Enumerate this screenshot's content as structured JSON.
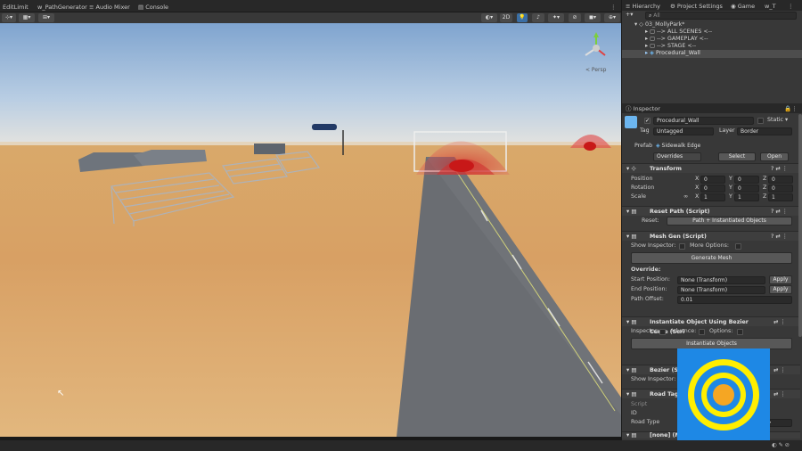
{
  "tabs": {
    "edit_limit": "EditLimit",
    "path_generator": "w_PathGenerator",
    "audio_mixer": "Audio Mixer",
    "console": "Console"
  },
  "scene_toolbar": {
    "mode_2d": "2D"
  },
  "hierarchy": {
    "tab_hierarchy": "Hierarchy",
    "tab_project_settings": "Project Settings",
    "tab_game": "Game",
    "tab_more": "w_T",
    "search_placeholder": "All",
    "scene_name": "03_MollyPark*",
    "items": [
      "--> ALL SCENES <--",
      "--> GAMEPLAY <--",
      "--> STAGE <--",
      "Procedural_Wall"
    ]
  },
  "inspector": {
    "tab_label": "Inspector",
    "object_name": "Procedural_Wall",
    "static_label": "Static",
    "tag_label": "Tag",
    "tag_value": "Untagged",
    "layer_label": "Layer",
    "layer_value": "Border",
    "prefab_label": "Prefab",
    "prefab_value": "Sidewalk Edge",
    "overrides": "Overrides",
    "select": "Select",
    "open": "Open",
    "transform": {
      "title": "Transform",
      "position_label": "Position",
      "rotation_label": "Rotation",
      "scale_label": "Scale",
      "x": "X",
      "y": "Y",
      "z": "Z",
      "pos": [
        "0",
        "0",
        "0"
      ],
      "rot": [
        "0",
        "0",
        "0"
      ],
      "scale": [
        "1",
        "1",
        "1"
      ]
    },
    "reset_path": {
      "title": "Reset Path (Script)",
      "reset_label": "Reset:",
      "reset_button": "Path + Instantiated Objects"
    },
    "mesh_gen": {
      "title": "Mesh Gen (Script)",
      "show_inspector": "Show Inspector:",
      "more_options": "More Options:",
      "generate_button": "Generate Mesh",
      "override_label": "Override:",
      "start_position_label": "Start Position:",
      "start_position_value": "None (Transform)",
      "end_position_label": "End Position:",
      "end_position_value": "None (Transform)",
      "apply": "Apply",
      "path_offset_label": "Path Offset:",
      "path_offset_value": "0.01"
    },
    "instantiate": {
      "title": "Instantiate Object Using Bezier Curve (Scri",
      "inspector_label": "Inspector:",
      "advance_label": "Advance:",
      "options_label": "Options:",
      "button": "Instantiate Objects"
    },
    "bezier": {
      "title": "Bezier (Sc",
      "show_inspector": "Show Inspector:"
    },
    "road_tag": {
      "title": "Road Tag (",
      "script_label": "Script",
      "id_label": "ID",
      "road_type_label": "Road Type"
    },
    "next_title": "[none] (M"
  },
  "colors": {
    "accent": "#1e88e5",
    "logo_yellow": "#ffee00",
    "logo_orange": "#f5a623"
  }
}
